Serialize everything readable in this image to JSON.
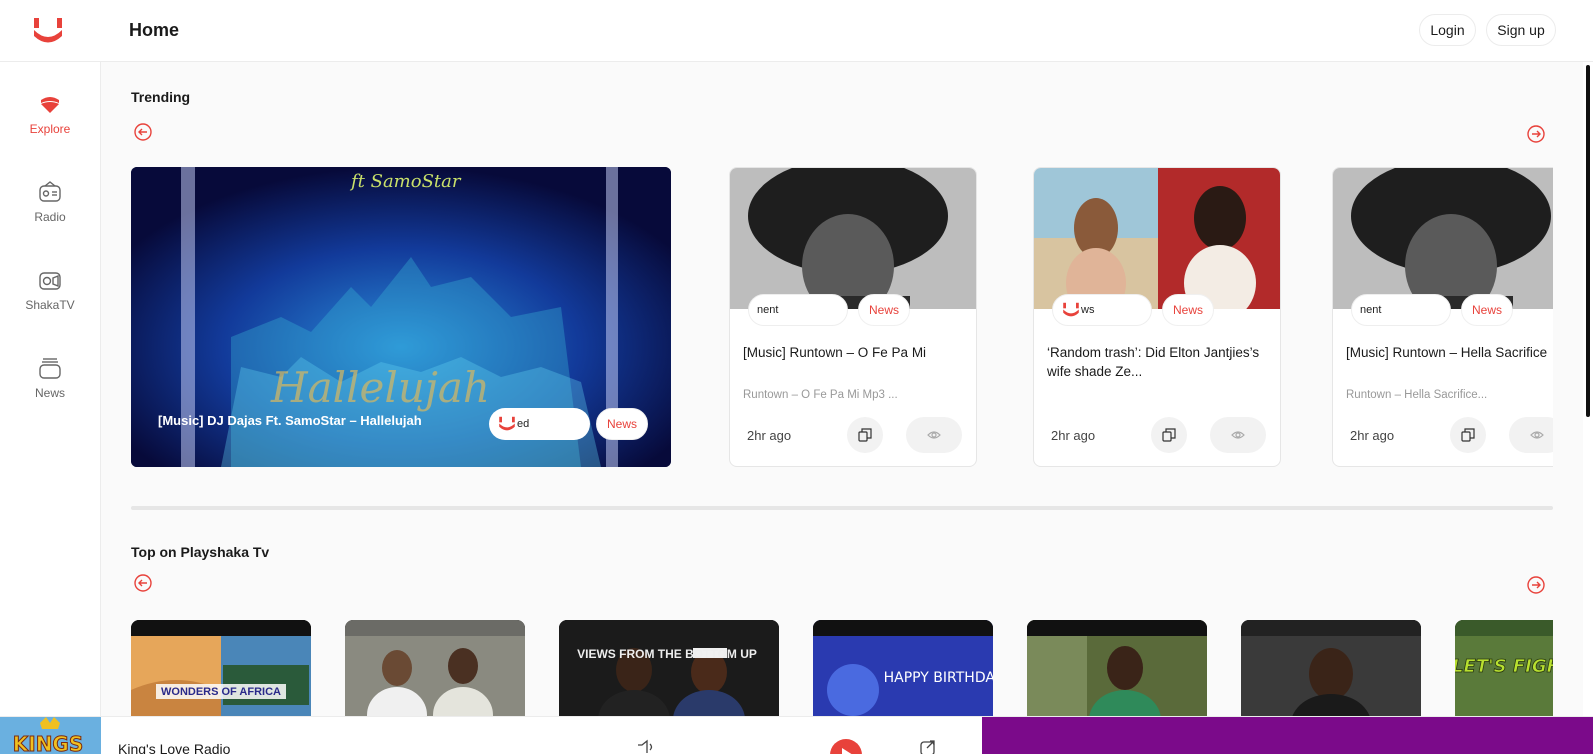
{
  "header": {
    "title": "Home",
    "login_label": "Login",
    "signup_label": "Sign up",
    "logo_icon": "playshaka-logo-icon"
  },
  "colors": {
    "accent": "#e8423b",
    "banner": "#7b0a8a"
  },
  "sidebar": {
    "items": [
      {
        "label": "Explore",
        "icon": "explore-icon",
        "active": true
      },
      {
        "label": "Radio",
        "icon": "radio-icon",
        "active": false
      },
      {
        "label": "ShakaTV",
        "icon": "tv-icon",
        "active": false
      },
      {
        "label": "News",
        "icon": "news-icon",
        "active": false
      }
    ]
  },
  "trending": {
    "title": "Trending",
    "feature": {
      "title": "[Music] DJ Dajas Ft. SamoStar – Hallelujah",
      "category": "ed",
      "tag": "News",
      "art_text_top": "ft SamoStar",
      "art_text_bottom": "Hallelujah"
    },
    "cards": [
      {
        "title": "[Music] Runtown – O Fe Pa Mi",
        "subtitle": "Runtown – O Fe Pa Mi Mp3 ...",
        "category": "nent",
        "tag": "News",
        "time": "2hr ago"
      },
      {
        "title": "‘Random trash’: Did Elton Jantjies’s wife shade Ze...",
        "subtitle": "",
        "category": "ws",
        "tag": "News",
        "time": "2hr ago"
      },
      {
        "title": "[Music] Runtown – Hella Sacrifice",
        "subtitle": "Runtown – Hella Sacrifice...",
        "category": "nent",
        "tag": "News",
        "time": "2hr ago"
      }
    ]
  },
  "tv": {
    "title": "Top on Playshaka Tv",
    "items": [
      {
        "caption": "WONDERS OF AFRICA"
      },
      {
        "caption": ""
      },
      {
        "caption": "VIEWS FROM THE BOTTOM UP"
      },
      {
        "caption": "HAPPY BIRTHDAY"
      },
      {
        "caption": ""
      },
      {
        "caption": ""
      },
      {
        "caption": "LET'S FIGHT"
      }
    ]
  },
  "player": {
    "station": "King's Love Radio",
    "thumb_text": "KINGS"
  }
}
